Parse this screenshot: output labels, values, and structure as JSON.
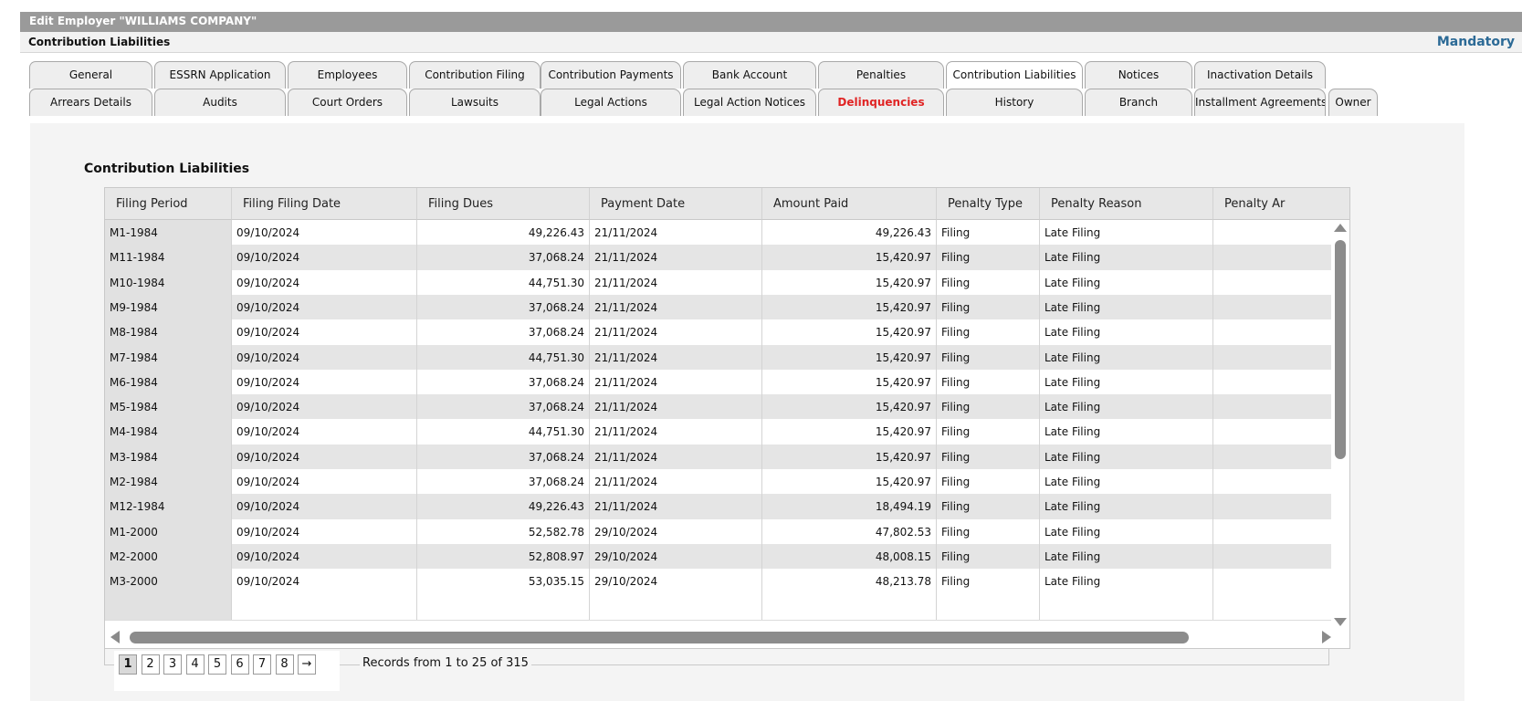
{
  "window": {
    "title": "Edit Employer \"WILLIAMS COMPANY\"",
    "subtitle": "Contribution Liabilities",
    "mandatory_label": "Mandatory"
  },
  "tabs": {
    "row1": [
      {
        "label": "General"
      },
      {
        "label": "ESSRN Application"
      },
      {
        "label": "Employees"
      },
      {
        "label": "Contribution Filing"
      },
      {
        "label": "Contribution Payments"
      },
      {
        "label": "Bank Account"
      },
      {
        "label": "Penalties"
      },
      {
        "label": "Contribution Liabilities",
        "active": true
      },
      {
        "label": "Notices"
      },
      {
        "label": "Inactivation Details"
      }
    ],
    "row2": [
      {
        "label": "Arrears Details"
      },
      {
        "label": "Audits"
      },
      {
        "label": "Court Orders"
      },
      {
        "label": "Lawsuits"
      },
      {
        "label": "Legal Actions"
      },
      {
        "label": "Legal Action Notices"
      },
      {
        "label": "Delinquencies",
        "alert": true,
        "alert_color": "#e02424"
      },
      {
        "label": "History"
      },
      {
        "label": "Branch"
      },
      {
        "label": "Installment Agreements"
      },
      {
        "label": "Owner"
      }
    ]
  },
  "section": {
    "title": "Contribution Liabilities"
  },
  "table": {
    "columns": [
      "Filing Period",
      "Filing Filing Date",
      "Filing Dues",
      "Payment Date",
      "Amount Paid",
      "Penalty Type",
      "Penalty Reason",
      "Penalty Ar"
    ],
    "rows": [
      [
        "M1-1984",
        "09/10/2024",
        "49,226.43",
        "21/11/2024",
        "49,226.43",
        "Filing",
        "Late Filing",
        ""
      ],
      [
        "M11-1984",
        "09/10/2024",
        "37,068.24",
        "21/11/2024",
        "15,420.97",
        "Filing",
        "Late Filing",
        ""
      ],
      [
        "M10-1984",
        "09/10/2024",
        "44,751.30",
        "21/11/2024",
        "15,420.97",
        "Filing",
        "Late Filing",
        ""
      ],
      [
        "M9-1984",
        "09/10/2024",
        "37,068.24",
        "21/11/2024",
        "15,420.97",
        "Filing",
        "Late Filing",
        ""
      ],
      [
        "M8-1984",
        "09/10/2024",
        "37,068.24",
        "21/11/2024",
        "15,420.97",
        "Filing",
        "Late Filing",
        ""
      ],
      [
        "M7-1984",
        "09/10/2024",
        "44,751.30",
        "21/11/2024",
        "15,420.97",
        "Filing",
        "Late Filing",
        ""
      ],
      [
        "M6-1984",
        "09/10/2024",
        "37,068.24",
        "21/11/2024",
        "15,420.97",
        "Filing",
        "Late Filing",
        ""
      ],
      [
        "M5-1984",
        "09/10/2024",
        "37,068.24",
        "21/11/2024",
        "15,420.97",
        "Filing",
        "Late Filing",
        ""
      ],
      [
        "M4-1984",
        "09/10/2024",
        "44,751.30",
        "21/11/2024",
        "15,420.97",
        "Filing",
        "Late Filing",
        ""
      ],
      [
        "M3-1984",
        "09/10/2024",
        "37,068.24",
        "21/11/2024",
        "15,420.97",
        "Filing",
        "Late Filing",
        ""
      ],
      [
        "M2-1984",
        "09/10/2024",
        "37,068.24",
        "21/11/2024",
        "15,420.97",
        "Filing",
        "Late Filing",
        ""
      ],
      [
        "M12-1984",
        "09/10/2024",
        "49,226.43",
        "21/11/2024",
        "18,494.19",
        "Filing",
        "Late Filing",
        ""
      ],
      [
        "M1-2000",
        "09/10/2024",
        "52,582.78",
        "29/10/2024",
        "47,802.53",
        "Filing",
        "Late Filing",
        ""
      ],
      [
        "M2-2000",
        "09/10/2024",
        "52,808.97",
        "29/10/2024",
        "48,008.15",
        "Filing",
        "Late Filing",
        ""
      ],
      [
        "M3-2000",
        "09/10/2024",
        "53,035.15",
        "29/10/2024",
        "48,213.78",
        "Filing",
        "Late Filing",
        ""
      ]
    ]
  },
  "pagination": {
    "pages": [
      "1",
      "2",
      "3",
      "4",
      "5",
      "6",
      "7",
      "8"
    ],
    "current": "1",
    "next_label": "→",
    "records_text": "Records from 1 to 25 of 315"
  }
}
